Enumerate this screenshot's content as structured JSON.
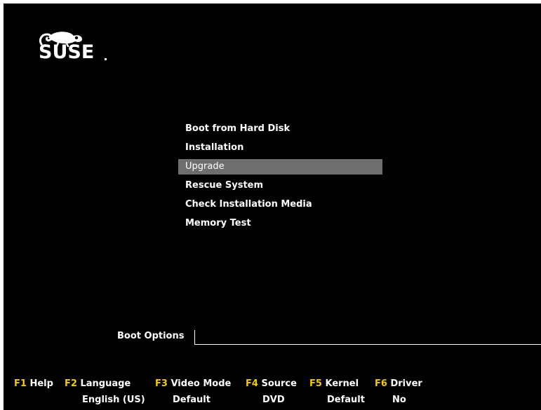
{
  "logo": {
    "text": "SUSE",
    "icon": "chameleon-icon"
  },
  "menu": {
    "items": [
      {
        "label": "Boot from Hard Disk"
      },
      {
        "label": "Installation"
      },
      {
        "label": "Upgrade"
      },
      {
        "label": "Rescue System"
      },
      {
        "label": "Check Installation Media"
      },
      {
        "label": "Memory Test"
      }
    ],
    "selected_index": 2
  },
  "boot_options": {
    "label": "Boot Options",
    "value": ""
  },
  "fkeys": [
    {
      "key": "F1",
      "label": "Help",
      "value": ""
    },
    {
      "key": "F2",
      "label": "Language",
      "value": "English (US)"
    },
    {
      "key": "F3",
      "label": "Video Mode",
      "value": "Default"
    },
    {
      "key": "F4",
      "label": "Source",
      "value": "DVD"
    },
    {
      "key": "F5",
      "label": "Kernel",
      "value": "Default"
    },
    {
      "key": "F6",
      "label": "Driver",
      "value": "No"
    }
  ],
  "colors": {
    "background": "#000000",
    "highlight": "#6e6e6e",
    "fkey": "#f2c81e",
    "text": "#ffffff"
  }
}
